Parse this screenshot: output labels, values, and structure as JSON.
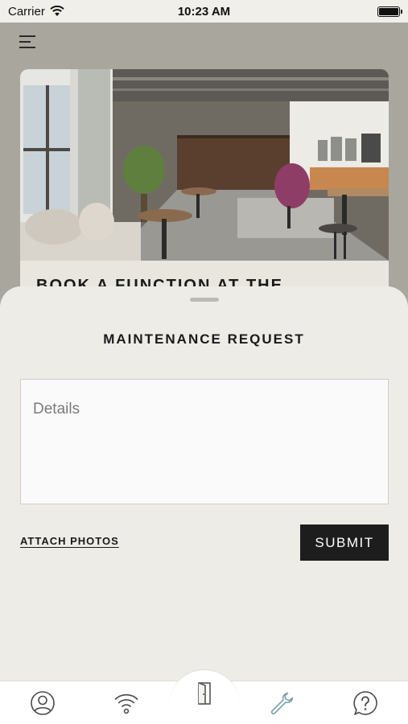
{
  "status_bar": {
    "carrier": "Carrier",
    "time": "10:23 AM"
  },
  "promo": {
    "title": "BOOK A FUNCTION AT THE"
  },
  "sheet": {
    "title": "MAINTENANCE REQUEST",
    "details_placeholder": "Details",
    "attach_label": "ATTACH PHOTOS",
    "submit_label": "SUBMIT"
  },
  "tab_bar": {
    "tabs": [
      {
        "icon": "profile-icon"
      },
      {
        "icon": "wifi-icon"
      },
      {
        "icon": "door-icon"
      },
      {
        "icon": "wrench-icon",
        "active_color": "#7aa3a9"
      },
      {
        "icon": "help-icon"
      }
    ]
  },
  "colors": {
    "accent": "#7aa3a9",
    "submit_bg": "#1d1d1d",
    "sheet_bg": "#edece7"
  }
}
